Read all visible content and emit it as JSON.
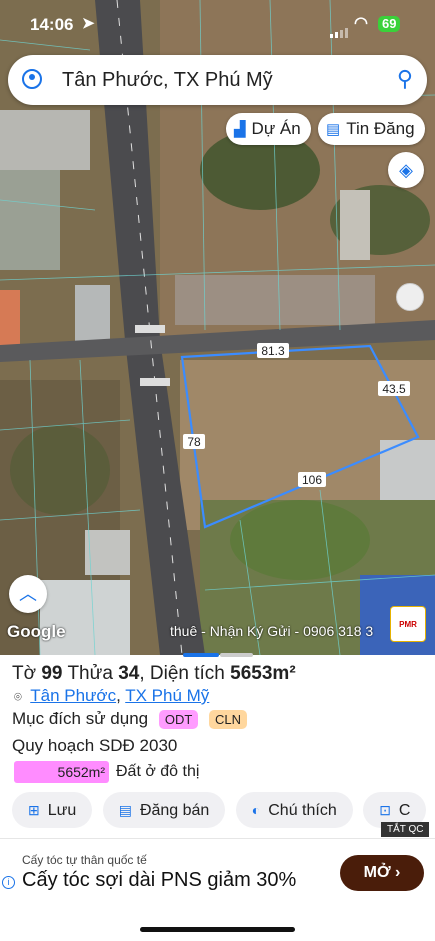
{
  "status_bar": {
    "time": "14:06",
    "battery": "69"
  },
  "search": {
    "query": "Tân Phước, TX Phú Mỹ"
  },
  "chips": {
    "du_an": "Dự Án",
    "tin_dang": "Tin Đăng"
  },
  "map": {
    "edge_labels": [
      "81.3",
      "43.5",
      "106",
      "78"
    ],
    "attribution": "Google",
    "contact": "thuê - Nhận Ký Gửi - 0906 318 3",
    "logo_text": "PMR"
  },
  "parcel": {
    "sheet_label": "Tờ",
    "sheet_no": "99",
    "plot_label": "Thửa",
    "plot_no": "34",
    "area_label": ", Diện tích",
    "area": "5653m²",
    "ward": "Tân Phước",
    "town": "TX Phú Mỹ",
    "purpose_label": "Mục đích sử dụng",
    "badges": [
      "ODT",
      "CLN"
    ],
    "plan_label": "Quy hoạch SDĐ 2030",
    "plan_area": "5652m²",
    "plan_type": "Đất ở đô thị"
  },
  "actions": [
    "Lưu",
    "Đăng bán",
    "Chú thích",
    "C"
  ],
  "ad": {
    "close_label": "TẮT QC",
    "subtitle": "Cấy tóc tự thân quốc tế",
    "title": "Cấy tóc sợi dài PNS giảm 30%",
    "cta": "MỞ"
  },
  "colors": {
    "accent": "#1a73e8",
    "odt": "#ff9cff",
    "cln": "#ffd79e",
    "cta": "#4a1d0a"
  }
}
